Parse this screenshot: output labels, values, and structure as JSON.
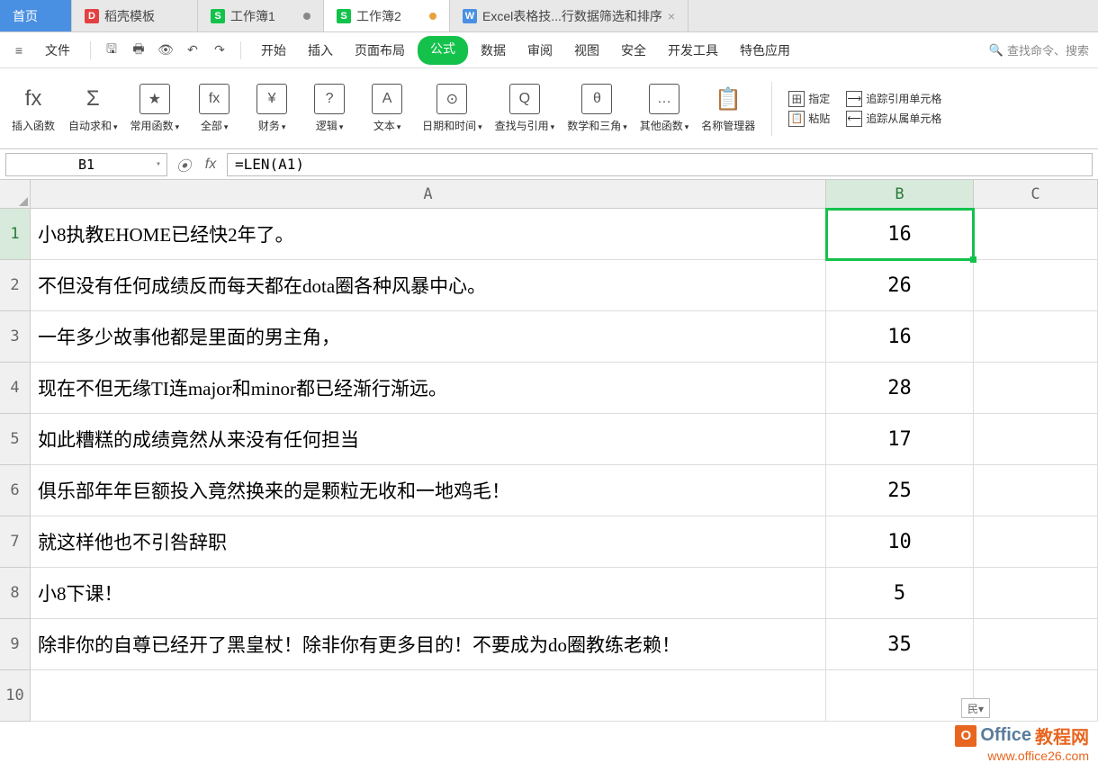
{
  "tabs": [
    {
      "label": "首页",
      "icon": "",
      "cls": "home"
    },
    {
      "label": "稻壳模板",
      "icon": "D",
      "iconbg": "#e34040"
    },
    {
      "label": "工作簿1",
      "icon": "S",
      "iconbg": "#14c24b",
      "dot": "#888"
    },
    {
      "label": "工作簿2",
      "icon": "S",
      "iconbg": "#14c24b",
      "dot": "#e8a23c",
      "active": true
    },
    {
      "label": "Excel表格技...行数据筛选和排序",
      "icon": "W",
      "iconbg": "#4a90e2",
      "close": true
    }
  ],
  "menu": {
    "file": "文件",
    "items": [
      "开始",
      "插入",
      "页面布局",
      "公式",
      "数据",
      "审阅",
      "视图",
      "安全",
      "开发工具",
      "特色应用"
    ],
    "active": "公式",
    "search": "查找命令、搜索"
  },
  "ribbon": [
    {
      "icon": "fx",
      "label": "插入函数"
    },
    {
      "icon": "Σ",
      "label": "自动求和",
      "drop": true
    },
    {
      "icon": "★",
      "label": "常用函数",
      "drop": true,
      "box": true
    },
    {
      "icon": "fx",
      "label": "全部",
      "drop": true,
      "box": true
    },
    {
      "icon": "¥",
      "label": "财务",
      "drop": true,
      "box": true
    },
    {
      "icon": "?",
      "label": "逻辑",
      "drop": true,
      "box": true
    },
    {
      "icon": "A",
      "label": "文本",
      "drop": true,
      "box": true
    },
    {
      "icon": "⊙",
      "label": "日期和时间",
      "drop": true,
      "box": true
    },
    {
      "icon": "Q",
      "label": "查找与引用",
      "drop": true,
      "box": true
    },
    {
      "icon": "θ",
      "label": "数学和三角",
      "drop": true,
      "box": true
    },
    {
      "icon": "…",
      "label": "其他函数",
      "drop": true,
      "box": true
    },
    {
      "icon": "📋",
      "label": "名称管理器"
    }
  ],
  "ribbon_right": {
    "paste": "粘贴",
    "define": "指定",
    "trace_ref": "追踪引用单元格",
    "trace_dep": "追踪从属单元格"
  },
  "namebox": "B1",
  "formula": "=LEN(A1)",
  "columns": [
    "A",
    "B",
    "C"
  ],
  "rows": [
    {
      "n": "1",
      "a": "小8执教EHOME已经快2年了。",
      "b": "16",
      "active": true
    },
    {
      "n": "2",
      "a": "不但没有任何成绩反而每天都在dota圈各种风暴中心。",
      "b": "26"
    },
    {
      "n": "3",
      "a": "一年多少故事他都是里面的男主角，",
      "b": "16"
    },
    {
      "n": "4",
      "a": "现在不但无缘TI连major和minor都已经渐行渐远。",
      "b": "28"
    },
    {
      "n": "5",
      "a": "如此糟糕的成绩竟然从来没有任何担当",
      "b": "17"
    },
    {
      "n": "6",
      "a": "俱乐部年年巨额投入竟然换来的是颗粒无收和一地鸡毛！",
      "b": "25"
    },
    {
      "n": "7",
      "a": "就这样他也不引咎辞职",
      "b": "10"
    },
    {
      "n": "8",
      "a": "小8下课！",
      "b": "5"
    },
    {
      "n": "9",
      "a": "除非你的自尊已经开了黑皇杖！除非你有更多目的！不要成为do圈教练老赖！",
      "b": "35"
    },
    {
      "n": "10",
      "a": "",
      "b": ""
    }
  ],
  "watermark": {
    "l1a": "Office",
    "l1b": "教程网",
    "l2": "www.office26.com"
  },
  "floatbtn": "民▾"
}
